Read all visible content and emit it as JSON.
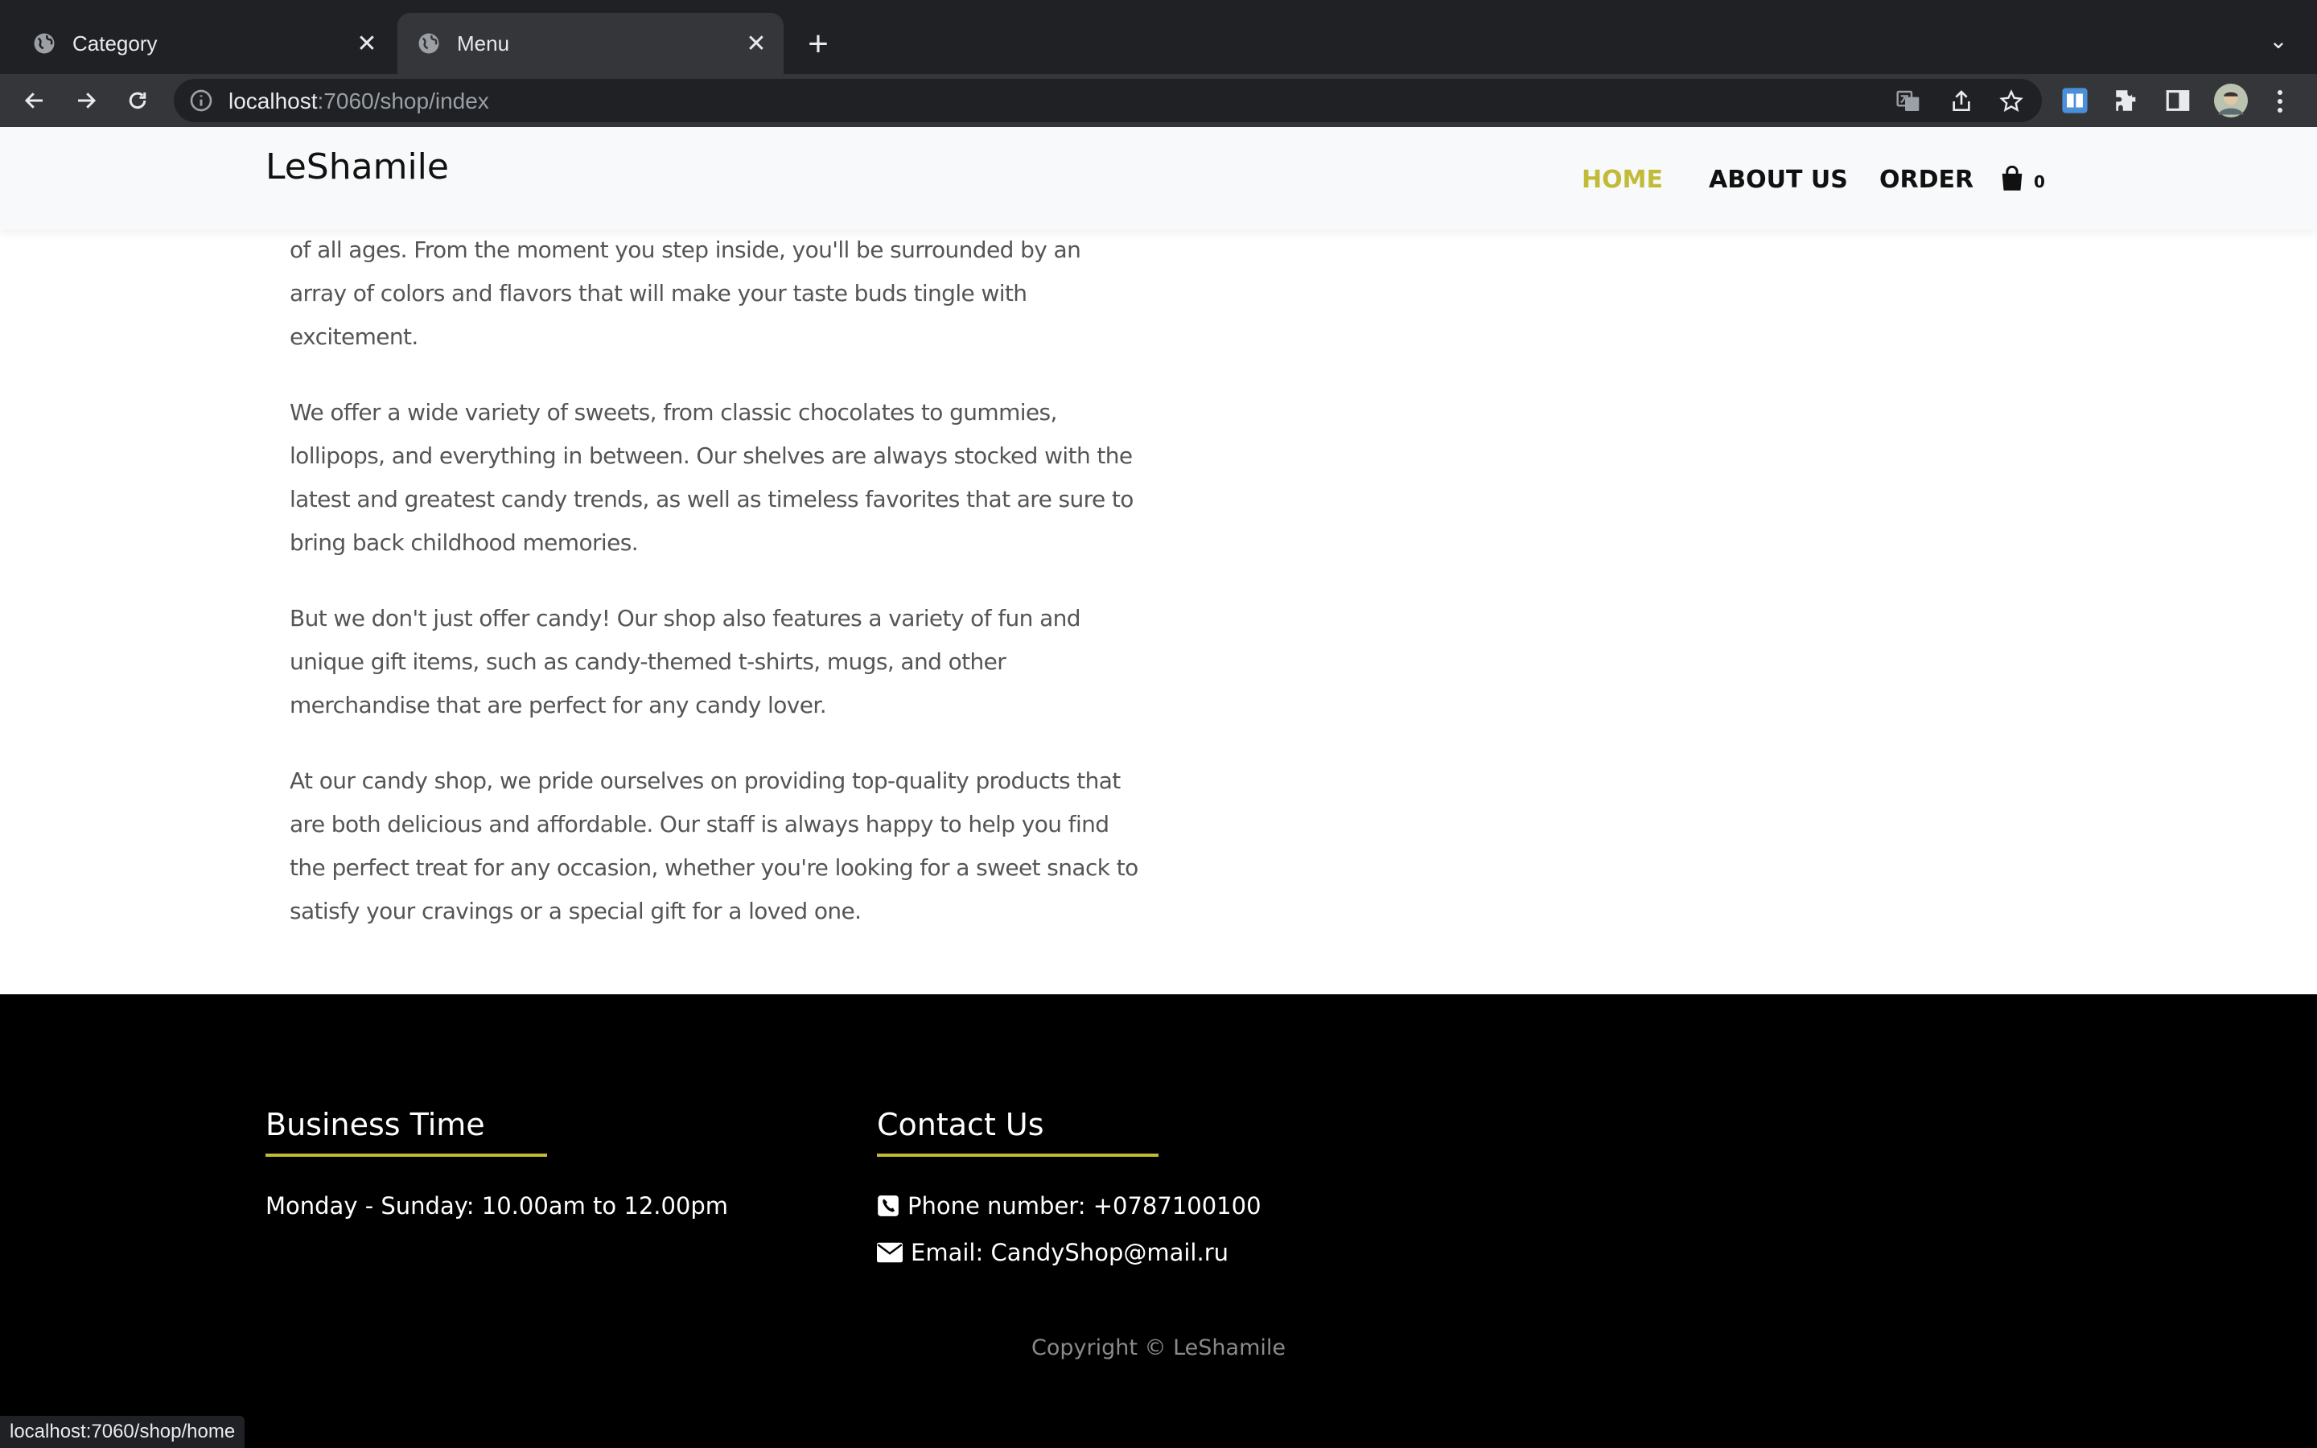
{
  "browser": {
    "tabs": [
      {
        "title": "Category"
      },
      {
        "title": "Menu"
      }
    ],
    "url_host": "localhost",
    "url_path": ":7060/shop/index",
    "status_url": "localhost:7060/shop/home"
  },
  "site": {
    "brand": "LeShamile",
    "nav": {
      "home": "HOME",
      "about": "ABOUT US",
      "order": "ORDER"
    },
    "cart_count": "0",
    "accent_color": "#c1bb39"
  },
  "content": {
    "paragraphs": [
      "of all ages. From the moment you step inside, you'll be surrounded by an array of colors and flavors that will make your taste buds tingle with excitement.",
      "We offer a wide variety of sweets, from classic chocolates to gummies, lollipops, and everything in between. Our shelves are always stocked with the latest and greatest candy trends, as well as timeless favorites that are sure to bring back childhood memories.",
      "But we don't just offer candy! Our shop also features a variety of fun and unique gift items, such as candy-themed t-shirts, mugs, and other merchandise that are perfect for any candy lover.",
      "At our candy shop, we pride ourselves on providing top-quality products that are both delicious and affordable. Our staff is always happy to help you find the perfect treat for any occasion, whether you're looking for a sweet snack to satisfy your cravings or a special gift for a loved one."
    ]
  },
  "footer": {
    "business_heading": "Business Time",
    "business_hours": "Monday - Sunday: 10.00am to 12.00pm",
    "contact_heading": "Contact Us",
    "phone": "Phone number: +0787100100",
    "email": "Email: CandyShop@mail.ru",
    "copyright": "Copyright © LeShamile"
  }
}
